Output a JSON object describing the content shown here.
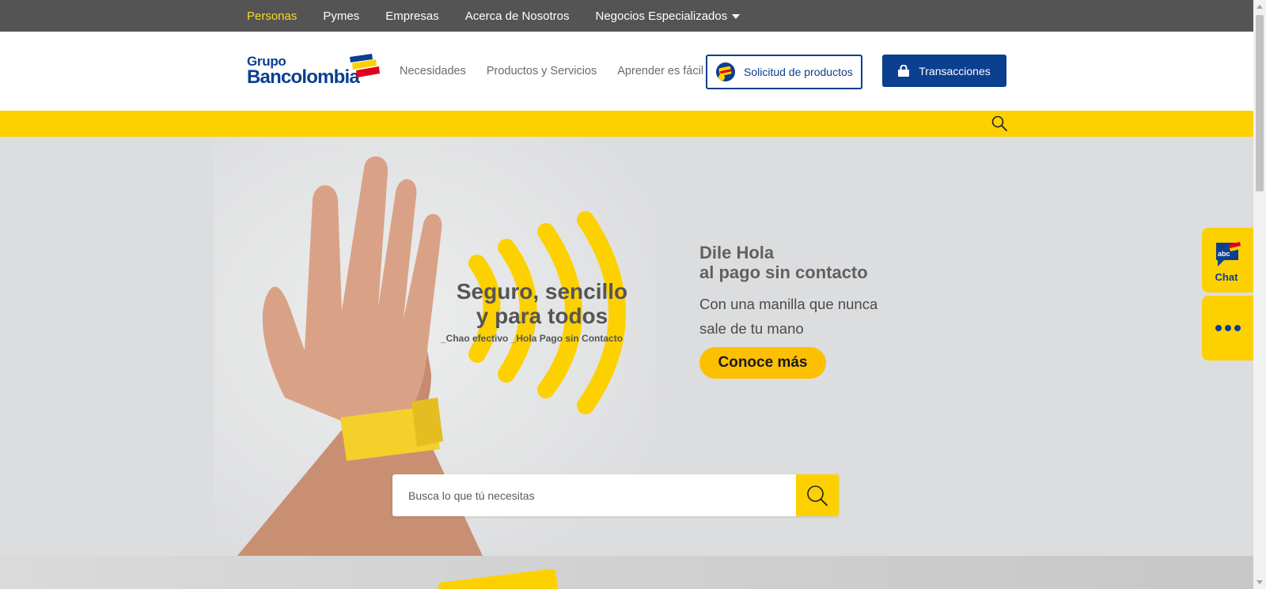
{
  "topbar": {
    "items": [
      {
        "label": "Personas",
        "active": true
      },
      {
        "label": "Pymes",
        "active": false
      },
      {
        "label": "Empresas",
        "active": false
      },
      {
        "label": "Acerca de Nosotros",
        "active": false
      },
      {
        "label": "Negocios Especializados",
        "active": false,
        "dropdown": true
      }
    ]
  },
  "header": {
    "logo": {
      "line1": "Grupo",
      "line2": "Bancolombia"
    },
    "nav": [
      "Necesidades",
      "Productos y Servicios",
      "Aprender es fácil"
    ],
    "solicitud_label": "Solicitud de productos",
    "transacciones_label": "Transacciones"
  },
  "hero": {
    "tagline_line1": "Seguro, sencillo",
    "tagline_line2": "y para todos",
    "tagline_line3": "_Chao efectivo _Hola Pago sin Contacto",
    "title_line1": "Dile Hola",
    "title_line2": "al pago sin contacto",
    "subtitle": "Con una manilla que nunca sale de tu mano",
    "cta": "Conoce más"
  },
  "search": {
    "placeholder": "Busca lo que tú necesitas"
  },
  "side": {
    "chat_label": "Chat",
    "chat_icon_text": "abc"
  },
  "colors": {
    "brand_blue": "#0b3f8f",
    "brand_yellow": "#fdd100",
    "topbar": "#545454",
    "active_nav": "#fdda24"
  },
  "icons": [
    "search-icon",
    "chevron-down-icon",
    "card-icon",
    "lock-icon",
    "chat-icon",
    "more-icon"
  ]
}
